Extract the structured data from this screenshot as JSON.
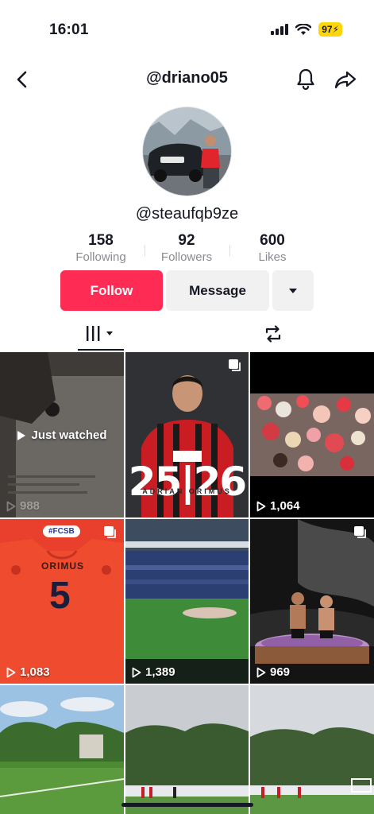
{
  "status_bar": {
    "time": "16:01",
    "battery": "97"
  },
  "nav": {
    "title": "@driano05"
  },
  "profile": {
    "username": "@steaufqb9ze"
  },
  "stats": [
    {
      "value": "158",
      "label": "Following"
    },
    {
      "value": "92",
      "label": "Followers"
    },
    {
      "value": "600",
      "label": "Likes"
    }
  ],
  "actions": {
    "follow": "Follow",
    "message": "Message"
  },
  "grid": {
    "just_watched": "Just watched",
    "tiles": [
      {
        "views": "988",
        "image_text": "25|26",
        "image_subtext": "ADRIAN ORIMUS"
      },
      {
        "views": "1,064"
      },
      {
        "views": "1,083",
        "sticker": "#FCSB",
        "jersey_name": "ORIMUS",
        "jersey_number": "5"
      },
      {
        "views": "1,389"
      },
      {
        "views": "969"
      }
    ]
  },
  "colors": {
    "accent": "#fe2c55",
    "battery": "#ffd60a",
    "text": "#161823",
    "muted": "#8a8b91"
  }
}
